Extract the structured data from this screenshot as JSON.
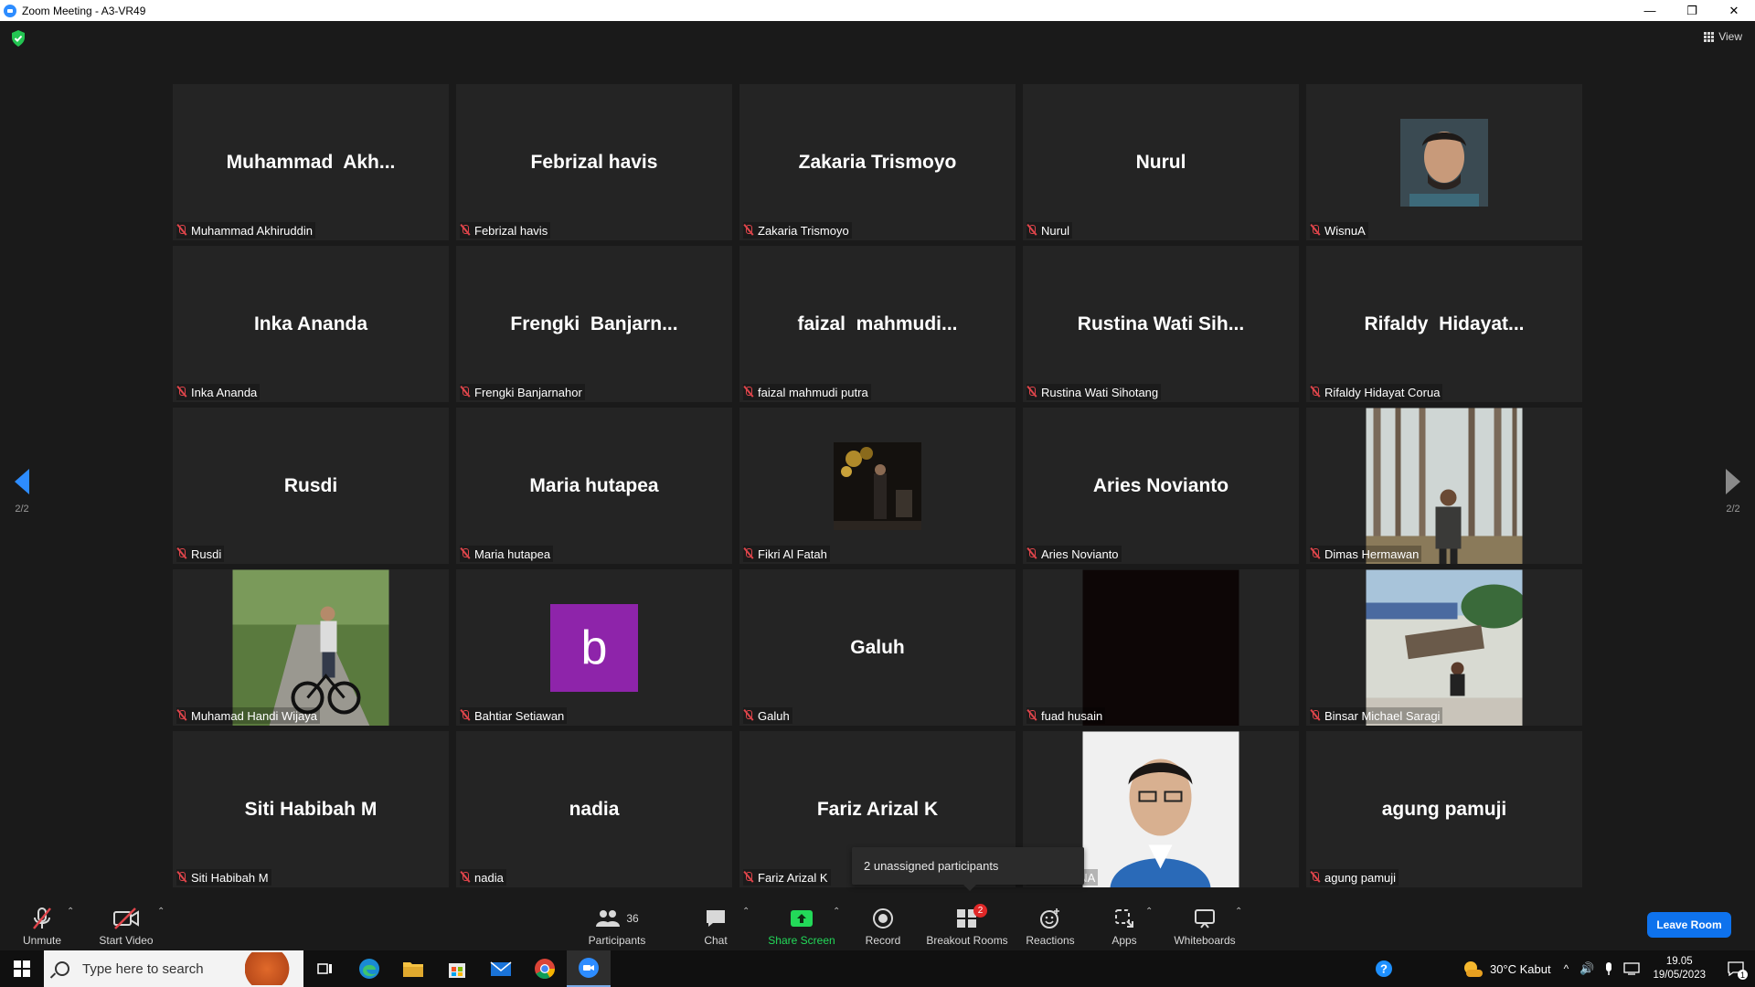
{
  "window": {
    "title": "Zoom Meeting - A3-VR49",
    "minimize": "—",
    "restore": "❐",
    "close": "✕"
  },
  "top": {
    "view_label": "View"
  },
  "pager": {
    "left": "2/2",
    "right": "2/2"
  },
  "tiles": [
    {
      "big": "Muhammad  Akh...",
      "name": "Muhammad Akhiruddin",
      "kind": "text"
    },
    {
      "big": "Febrizal havis",
      "name": "Febrizal havis",
      "kind": "text"
    },
    {
      "big": "Zakaria Trismoyo",
      "name": "Zakaria Trismoyo",
      "kind": "text"
    },
    {
      "big": "Nurul",
      "name": "Nurul",
      "kind": "text"
    },
    {
      "big": "",
      "name": "WisnuA",
      "kind": "photo-portrait"
    },
    {
      "big": "Inka Ananda",
      "name": "Inka Ananda",
      "kind": "text"
    },
    {
      "big": "Frengki  Banjarn...",
      "name": "Frengki Banjarnahor",
      "kind": "text"
    },
    {
      "big": "faizal  mahmudi...",
      "name": "faizal mahmudi putra",
      "kind": "text"
    },
    {
      "big": "Rustina Wati Sih...",
      "name": "Rustina Wati Sihotang",
      "kind": "text"
    },
    {
      "big": "Rifaldy  Hidayat...",
      "name": "Rifaldy Hidayat Corua",
      "kind": "text"
    },
    {
      "big": "Rusdi",
      "name": "Rusdi",
      "kind": "text"
    },
    {
      "big": "Maria hutapea",
      "name": "Maria hutapea",
      "kind": "text"
    },
    {
      "big": "",
      "name": "Fikri Al Fatah",
      "kind": "photo-party"
    },
    {
      "big": "Aries Novianto",
      "name": "Aries Novianto",
      "kind": "text"
    },
    {
      "big": "",
      "name": "Dimas Hermawan",
      "kind": "photo-forest"
    },
    {
      "big": "",
      "name": "Muhamad Handi Wijaya",
      "kind": "photo-bike"
    },
    {
      "big": "b",
      "name": "Bahtiar Setiawan",
      "kind": "avatar"
    },
    {
      "big": "Galuh",
      "name": "Galuh",
      "kind": "text"
    },
    {
      "big": "",
      "name": "fuad husain",
      "kind": "photo-dark"
    },
    {
      "big": "",
      "name": "Binsar Michael Saragi",
      "kind": "photo-beach"
    },
    {
      "big": "Siti Habibah M",
      "name": "Siti Habibah M",
      "kind": "text"
    },
    {
      "big": "nadia",
      "name": "nadia",
      "kind": "text"
    },
    {
      "big": "Fariz Arizal K",
      "name": "Fariz Arizal K",
      "kind": "text"
    },
    {
      "big": "",
      "name": "WARDHANA",
      "kind": "photo-id"
    },
    {
      "big": "agung pamuji",
      "name": "agung pamuji",
      "kind": "text"
    }
  ],
  "tooltip": "2 unassigned participants",
  "toolbar": {
    "unmute": "Unmute",
    "start_video": "Start Video",
    "participants": "Participants",
    "participants_count": "36",
    "chat": "Chat",
    "share_screen": "Share Screen",
    "record": "Record",
    "breakout_rooms": "Breakout Rooms",
    "breakout_badge": "2",
    "reactions": "Reactions",
    "apps": "Apps",
    "whiteboards": "Whiteboards",
    "leave": "Leave Room"
  },
  "taskbar": {
    "search_placeholder": "Type here to search",
    "weather": "30°C  Kabut",
    "time": "19.05",
    "date": "19/05/2023",
    "notif_count": "1"
  },
  "colors": {
    "accent": "#2d8cff",
    "muted_red": "#e0454b",
    "share_green": "#23d959",
    "leave_blue": "#0e72ed"
  }
}
